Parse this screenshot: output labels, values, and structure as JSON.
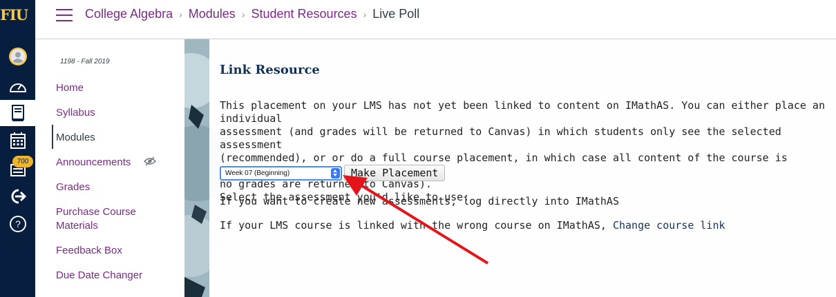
{
  "global_nav": {
    "logo": "FIU",
    "badge_count": "700",
    "items": [
      "account-icon",
      "dashboard-icon",
      "courses-icon",
      "calendar-icon",
      "inbox-icon",
      "logout-icon",
      "help-icon"
    ]
  },
  "header": {
    "breadcrumb": [
      "College Algebra",
      "Modules",
      "Student Resources"
    ],
    "current": "Live Poll"
  },
  "course_nav": {
    "term": "1198 - Fall 2019",
    "items": [
      "Home",
      "Syllabus",
      "Modules",
      "Announcements",
      "Grades",
      "Purchase Course Materials",
      "Feedback Box",
      "Due Date Changer"
    ]
  },
  "content": {
    "title": "Link Resource",
    "paragraph": "This placement on your LMS has not yet been linked to content on IMathAS. You can either place an individual\nassessment (and grades will be returned to Canvas) in which students only see the selected assessment\n(recommended), or or do a full course placement, in which case all content of the course is available to studen\nno grades are returned to Canvas).\nSelect the assessment you'd like to use:",
    "select_value": "Week 07 (Beginning)",
    "button_label": "Make Placement",
    "line1": "If you want to create new assessments, log directly into IMathAS",
    "line2_prefix": "If your LMS course is linked with the wrong course on IMathAS, ",
    "line2_link": "Change course link"
  },
  "colors": {
    "nav_bg": "#081e3f",
    "accent": "#7a2a86",
    "title": "#163253",
    "arrow": "#e4141b"
  }
}
